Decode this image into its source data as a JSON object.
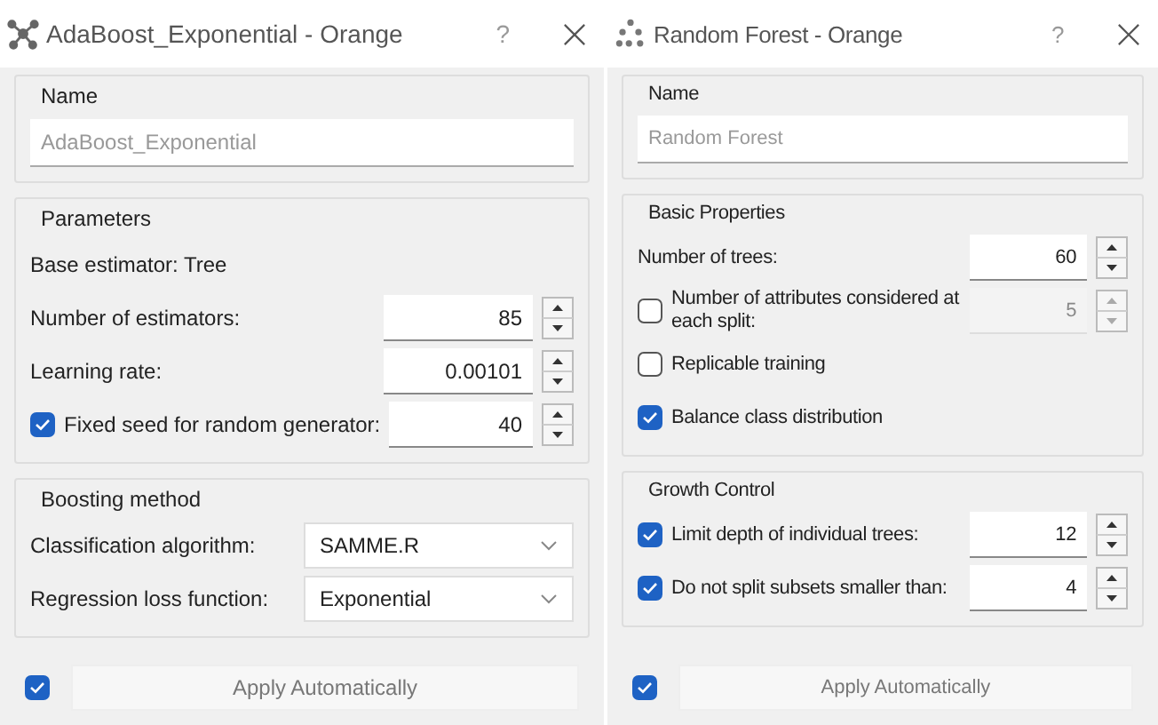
{
  "windows": [
    {
      "title": "AdaBoost_Exponential - Orange",
      "help": "?",
      "sections": [
        {
          "title": "Name",
          "rows": [
            {
              "kind": "field",
              "placeholder": "AdaBoost_Exponential"
            }
          ]
        },
        {
          "title": "Parameters",
          "rows": [
            {
              "kind": "text",
              "label": "Base estimator: Tree"
            },
            {
              "kind": "spin",
              "label": "Number of estimators:",
              "value": "85",
              "disabled": false
            },
            {
              "kind": "spin",
              "label": "Learning rate:",
              "value": "0.00101",
              "disabled": false
            },
            {
              "kind": "check_spin",
              "label": "Fixed seed for random generator:",
              "checked": true,
              "value": "40",
              "disabled": false
            }
          ]
        },
        {
          "title": "Boosting method",
          "rows": [
            {
              "kind": "combo",
              "label": "Classification algorithm:",
              "value": "SAMME.R"
            },
            {
              "kind": "combo",
              "label": "Regression loss function:",
              "value": "Exponential"
            }
          ]
        }
      ],
      "apply": {
        "checked": true,
        "label": "Apply Automatically"
      }
    },
    {
      "title": "Random Forest - Orange",
      "help": "?",
      "sections": [
        {
          "title": "Name",
          "rows": [
            {
              "kind": "field",
              "placeholder": "Random Forest"
            }
          ]
        },
        {
          "title": "Basic Properties",
          "rows": [
            {
              "kind": "spin",
              "label": "Number of trees:",
              "value": "60",
              "disabled": false
            },
            {
              "kind": "check_spin",
              "label": "Number of attributes considered at each split:",
              "checked": false,
              "value": "5",
              "disabled": true
            },
            {
              "kind": "check",
              "label": "Replicable training",
              "checked": false
            },
            {
              "kind": "check",
              "label": "Balance class distribution",
              "checked": true
            }
          ]
        },
        {
          "title": "Growth Control",
          "rows": [
            {
              "kind": "check_spin",
              "label": "Limit depth of individual trees:",
              "checked": true,
              "value": "12",
              "disabled": false
            },
            {
              "kind": "check_spin",
              "label": "Do not split subsets smaller than:",
              "checked": true,
              "value": "4",
              "disabled": false
            }
          ]
        }
      ],
      "apply": {
        "checked": true,
        "label": "Apply Automatically"
      }
    }
  ]
}
